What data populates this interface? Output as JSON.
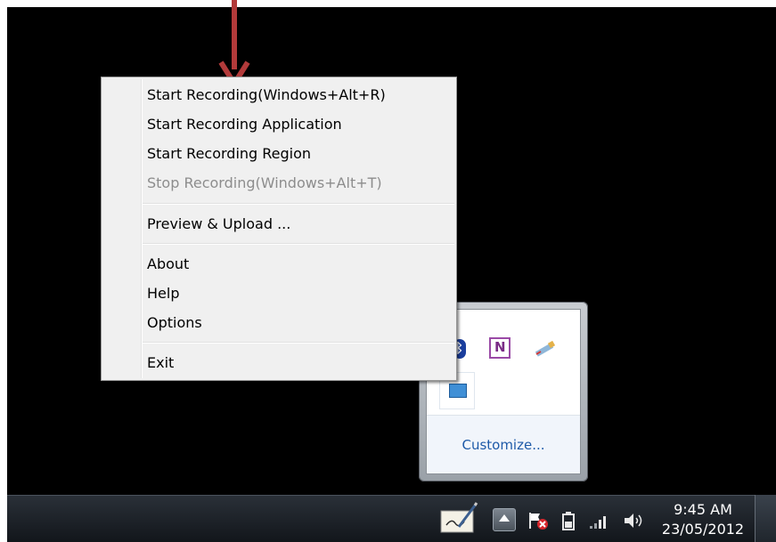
{
  "menu": {
    "items": [
      {
        "label": "Start Recording(Windows+Alt+R)",
        "enabled": true
      },
      {
        "label": "Start Recording Application",
        "enabled": true
      },
      {
        "label": "Start Recording Region",
        "enabled": true
      },
      {
        "label": "Stop Recording(Windows+Alt+T)",
        "enabled": false
      },
      {
        "label": "Preview & Upload ...",
        "enabled": true
      },
      {
        "label": "About",
        "enabled": true
      },
      {
        "label": "Help",
        "enabled": true
      },
      {
        "label": "Options",
        "enabled": true
      },
      {
        "label": "Exit",
        "enabled": true
      }
    ]
  },
  "tray_popup": {
    "customize_label": "Customize...",
    "icons": [
      "bluetooth-icon",
      "onenote-icon",
      "pen-input-icon",
      "recorder-app-icon"
    ],
    "onenote_glyph": "N"
  },
  "taskbar": {
    "time": "9:45 AM",
    "date": "23/05/2012",
    "icons": [
      "tablet-input-icon",
      "show-hidden-icons-arrow",
      "action-center-flag-icon",
      "battery-icon",
      "network-signal-icon",
      "volume-icon"
    ]
  },
  "colors": {
    "annotation_arrow": "#b23a3a",
    "desktop": "#000000",
    "menu_background": "#f0f0f0",
    "disabled_text": "#8d8d8d",
    "link": "#1e5aa8"
  }
}
